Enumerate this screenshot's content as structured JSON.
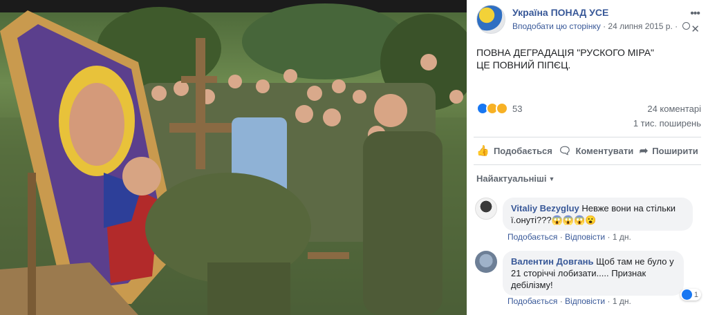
{
  "post": {
    "page_name": "Україна ПОНАД УСЕ",
    "like_page_label": "Вподобати цю сторінку",
    "date": "24 липня 2015 р.",
    "dot_separator": "·",
    "text_line1": "ПОВНА ДЕГРАДАЦІЯ \"РУСКОГО МІРА\"",
    "text_line2": "ЦЕ ПОВНИЙ ПІПЄЦ."
  },
  "stats": {
    "reaction_icons": [
      "like-icon",
      "haha-icon",
      "wow-icon"
    ],
    "reaction_count": "53",
    "comments": "24 коментарі",
    "shares": "1 тис. поширень"
  },
  "actions": {
    "like": "Подобається",
    "comment": "Коментувати",
    "share": "Поширити"
  },
  "sort_label": "Найактуальніші",
  "comments": [
    {
      "author": "Vitaliy Bezygluy",
      "text_line1": " Невже вони на стільки",
      "text_line2": "ї.онуті???😱😱😱😮",
      "like": "Подобається",
      "reply": "Відповісти",
      "time": "1 дн.",
      "dot": "·"
    },
    {
      "author": "Валентин Довгань",
      "text_line1": " Щоб там не було у",
      "text_line2": "21 сторіччі лобизати..... Признак",
      "text_line3": "дебілізму!",
      "like": "Подобається",
      "reply": "Відповісти",
      "time": "1 дн.",
      "dot": "·",
      "like_count": "1"
    }
  ],
  "colors": {
    "link": "#385898",
    "secondary_text": "#606770",
    "like_blue": "#1877f2",
    "bubble_bg": "#f2f3f5"
  }
}
